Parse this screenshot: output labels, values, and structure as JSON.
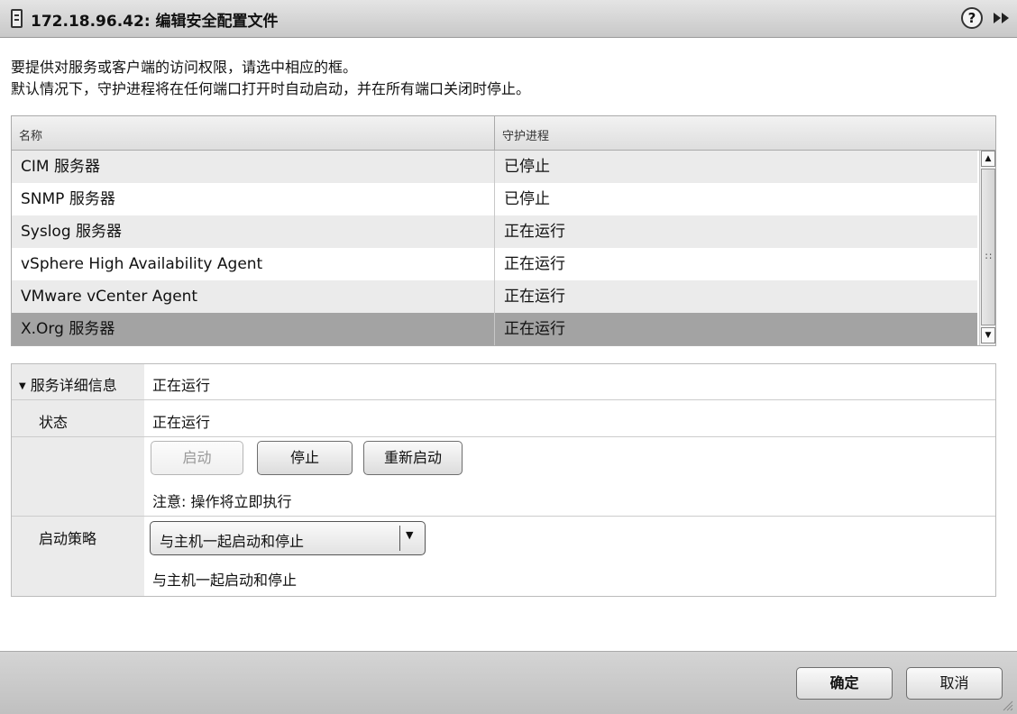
{
  "window": {
    "title": "172.18.96.42: 编辑安全配置文件",
    "icons": {
      "host": "host-icon",
      "help": "help-icon",
      "expand": "expand-icon"
    }
  },
  "description": {
    "line1": "要提供对服务或客户端的访问权限，请选中相应的框。",
    "line2": "默认情况下，守护进程将在任何端口打开时自动启动，并在所有端口关闭时停止。"
  },
  "services_table": {
    "columns": {
      "name": "名称",
      "daemon": "守护进程"
    },
    "rows": [
      {
        "name": "CIM 服务器",
        "status": "已停止"
      },
      {
        "name": "SNMP 服务器",
        "status": "已停止"
      },
      {
        "name": "Syslog 服务器",
        "status": "正在运行"
      },
      {
        "name": "vSphere High Availability Agent",
        "status": "正在运行"
      },
      {
        "name": "VMware vCenter Agent",
        "status": "正在运行"
      },
      {
        "name": "X.Org 服务器",
        "status": "正在运行"
      }
    ],
    "selected_index": 5
  },
  "details": {
    "header_label": "服务详细信息",
    "header_value": "正在运行",
    "status_label": "状态",
    "status_value": "正在运行",
    "buttons": {
      "start": "启动",
      "stop": "停止",
      "restart": "重新启动"
    },
    "note": "注意: 操作将立即执行",
    "policy_label": "启动策略",
    "policy_selected": "与主机一起启动和停止",
    "policy_text": "与主机一起启动和停止"
  },
  "footer": {
    "ok": "确定",
    "cancel": "取消"
  },
  "colors": {
    "selected_row": "#a3a3a3",
    "alt_row": "#ebebeb",
    "title_bar": "#d6d6d6"
  }
}
